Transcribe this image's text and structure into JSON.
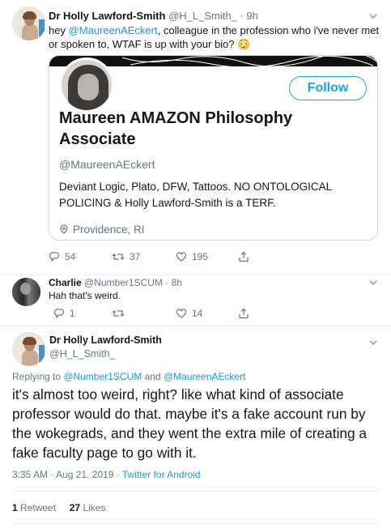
{
  "tweet1": {
    "display_name": "Dr Holly Lawford-Smith",
    "handle": "@H_L_Smith_",
    "separator": "·",
    "time": "9h",
    "text_prefix": "hey ",
    "mention": "@MaureenAEckert",
    "text_suffix": ", colleague in the profession who i've never met or spoken to, WTAF is up with your bio? 😳",
    "card": {
      "follow_label": "Follow",
      "name": "Maureen AMAZON Philosophy Associate",
      "handle": "@MaureenAEckert",
      "bio": "Deviant Logic, Plato, DFW, Tattoos.  NO ONTOLOGICAL POLICING & Holly Lawford-Smith is a TERF.",
      "location": "Providence, RI"
    },
    "replies": "54",
    "retweets": "37",
    "likes": "195"
  },
  "tweet2": {
    "display_name": "Charlie",
    "handle": "@Number1SCUM",
    "separator": "·",
    "time": "8h",
    "text": "Hah that's weird.",
    "replies": "1",
    "retweets": "",
    "likes": "14"
  },
  "tweet3": {
    "display_name": "Dr Holly Lawford-Smith",
    "handle": "@H_L_Smith_",
    "replying_prefix": "Replying to ",
    "replying_user1": "@Number1SCUM",
    "replying_and": " and ",
    "replying_user2": "@MaureenAEckert",
    "text": "it's almost too weird, right? like what kind of associate professor would do that. maybe it's a fake account run by the wokegrads, and they went the extra mile of creating a fake faculty page to go with it.",
    "time": "3:35 AM · Aug 21, 2019",
    "dot": " · ",
    "client": "Twitter for Android",
    "retweet_count": "1",
    "retweet_label": "Retweet",
    "like_count": "27",
    "like_label": "Likes"
  },
  "icons": {
    "reply": "reply-icon",
    "retweet": "retweet-icon",
    "like": "heart-icon",
    "share": "share-icon",
    "menu": "chevron-down-icon",
    "location": "location-pin-icon"
  },
  "colors": {
    "link": "#1b95e0",
    "follow": "#1da1f2",
    "secondary_text": "#657786",
    "border": "#e6ecf0"
  }
}
